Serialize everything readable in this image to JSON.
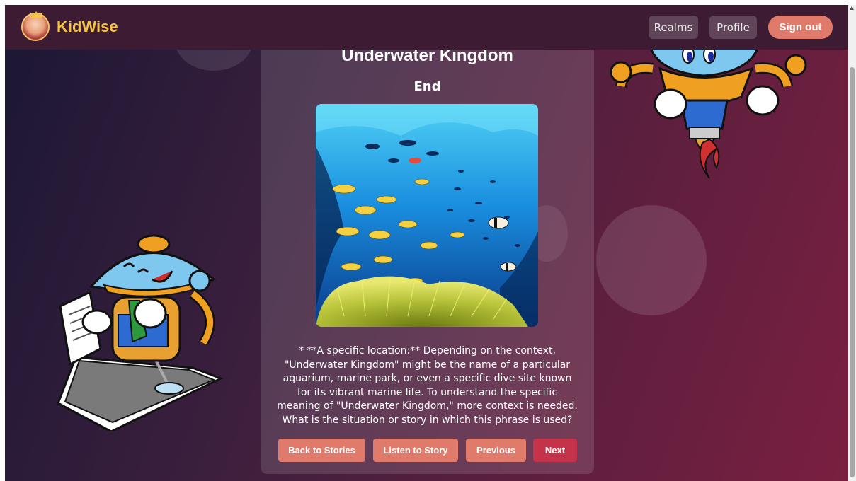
{
  "app": {
    "name": "KidWise",
    "logo_icon": "princess-avatar-icon"
  },
  "nav": {
    "realms_label": "Realms",
    "profile_label": "Profile",
    "signout_label": "Sign out"
  },
  "story": {
    "title": "Underwater Kingdom",
    "page_label": "End",
    "image_icon": "underwater-reef-illustration",
    "text": "* **A specific location:** Depending on the context, \"Underwater Kingdom\" might be the name of a particular aquarium, marine park, or even a specific dive site known for its vibrant marine life. To understand the specific meaning of \"Underwater Kingdom,\" more context is needed. What is the situation or story in which this phrase is used?"
  },
  "actions": {
    "back_label": "Back to Stories",
    "listen_label": "Listen to Story",
    "previous_label": "Previous",
    "next_label": "Next"
  },
  "colors": {
    "brand": "#f5c542",
    "button": "#e07a6a",
    "next_button": "#c4334a",
    "header": "#3d1b32"
  }
}
